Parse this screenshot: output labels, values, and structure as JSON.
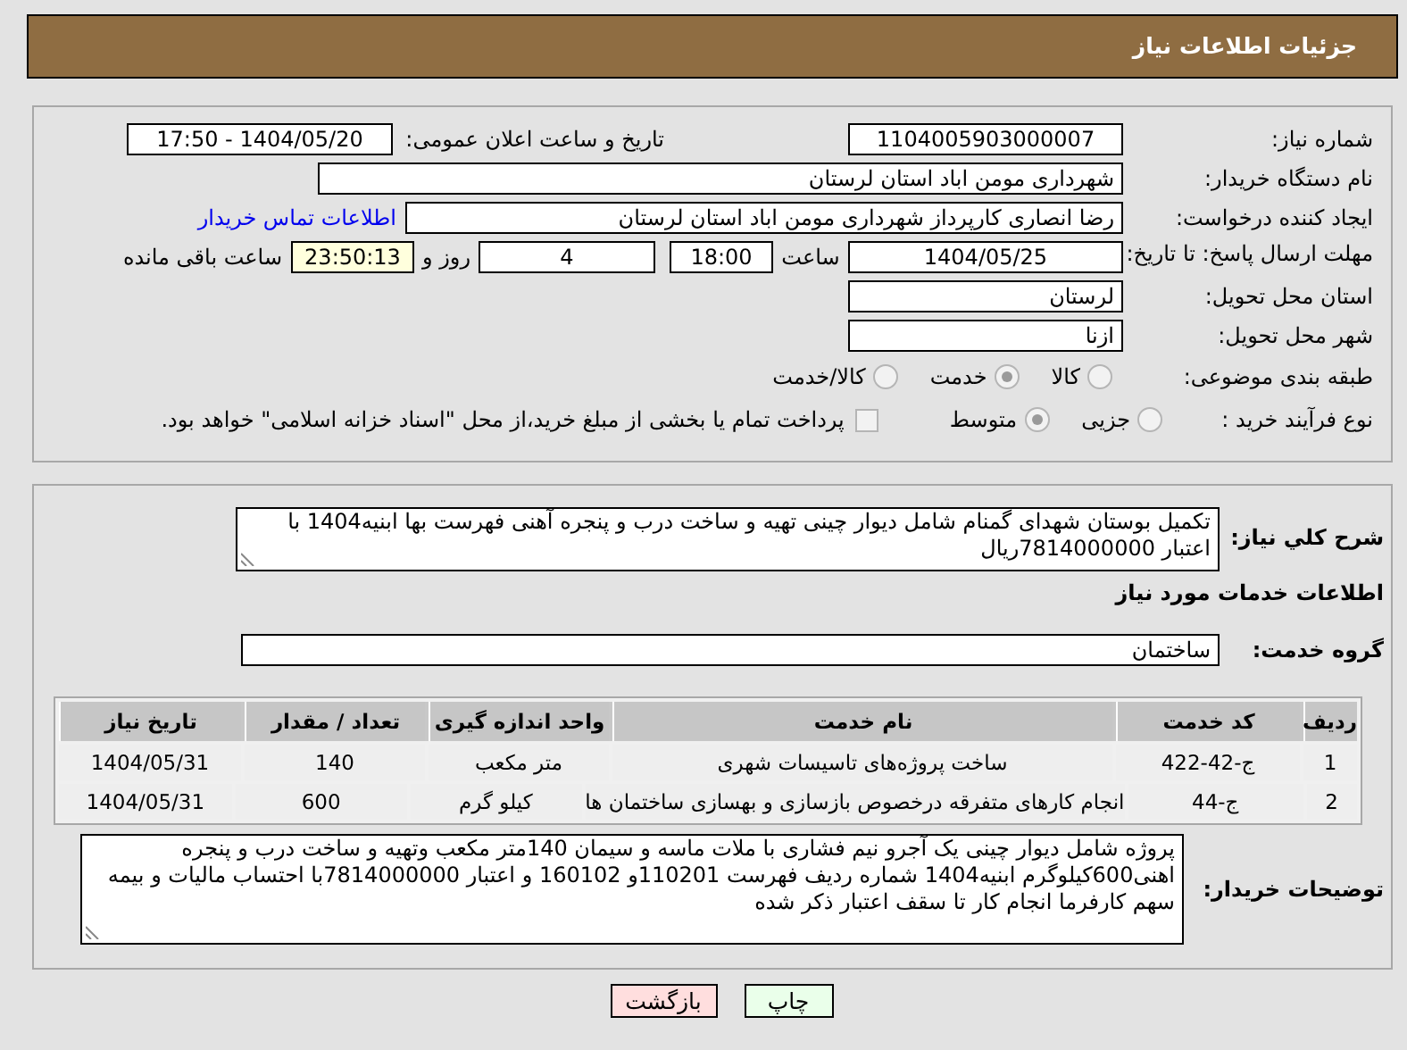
{
  "header": {
    "title": "جزئیات اطلاعات نیاز"
  },
  "need_number": {
    "label": "شماره نیاز:",
    "value": "1104005903000007"
  },
  "announce": {
    "label": "تاریخ و ساعت اعلان عمومی:",
    "value": "1404/05/20 - 17:50"
  },
  "buyer": {
    "label": "نام دستگاه خریدار:",
    "value": "شهرداری مومن اباد استان لرستان"
  },
  "creator": {
    "label": "ایجاد کننده درخواست:",
    "value": "رضا انصاری کارپرداز شهرداری مومن اباد استان لرستان",
    "link": "اطلاعات تماس خریدار"
  },
  "deadline": {
    "label": "مهلت ارسال پاسخ: تا تاریخ:",
    "date": "1404/05/25",
    "time_label": "ساعت",
    "time": "18:00",
    "days": "4",
    "days_label": "روز و",
    "remaining": "23:50:13",
    "remaining_label": "ساعت باقی مانده"
  },
  "province": {
    "label": "استان محل تحویل:",
    "value": "لرستان"
  },
  "city": {
    "label": "شهر محل تحویل:",
    "value": "ازنا"
  },
  "category": {
    "label": "طبقه بندی موضوعی:",
    "options": [
      {
        "label": "کالا",
        "selected": false
      },
      {
        "label": "خدمت",
        "selected": true
      },
      {
        "label": "کالا/خدمت",
        "selected": false
      }
    ]
  },
  "purchase_type": {
    "label": "نوع فرآیند خرید :",
    "options": [
      {
        "label": "جزیی",
        "selected": false
      },
      {
        "label": "متوسط",
        "selected": true
      }
    ],
    "payment_note": {
      "label": "پرداخت تمام یا بخشی از مبلغ خرید،از محل \"اسناد خزانه اسلامی\" خواهد بود.",
      "checked": false
    }
  },
  "summary": {
    "label": "شرح کلي نياز:",
    "value": "تکمیل بوستان شهدای گمنام شامل دیوار چینی تهیه و ساخت درب و پنجره آهنی فهرست بها ابنیه1404 با اعتبار 7814000000ریال"
  },
  "services_title": "اطلاعات خدمات مورد نياز",
  "service_group": {
    "label": "گروه خدمت:",
    "value": "ساختمان"
  },
  "table": {
    "columns": [
      "ردیف",
      "کد خدمت",
      "نام خدمت",
      "واحد اندازه گیری",
      "تعداد / مقدار",
      "تاریخ نیاز"
    ],
    "rows": [
      [
        "1",
        "ج-42-422",
        "ساخت پروژه‌های تاسیسات شهری",
        "متر مکعب",
        "140",
        "1404/05/31"
      ],
      [
        "2",
        "ج-44",
        "انجام کارهای متفرقه درخصوص بازسازی و بهسازی ساختمان ها",
        "کیلو گرم",
        "600",
        "1404/05/31"
      ]
    ]
  },
  "buyer_notes": {
    "label": "توضیحات خریدار:",
    "value": "پروژه شامل دیوار چینی یک آجرو نیم فشاری با ملات ماسه و سیمان 140متر مکعب وتهیه و ساخت درب و پنجره اهنی600کیلوگرم ابنیه1404 شماره ردیف فهرست 110201و 160102 و اعتبار 7814000000با احتساب مالیات و بیمه سهم کارفرما انجام کار تا سقف اعتبار ذکر شده"
  },
  "buttons": [
    {
      "label": "چاپ",
      "kind": "print"
    },
    {
      "label": "بازگشت",
      "kind": "back"
    }
  ]
}
